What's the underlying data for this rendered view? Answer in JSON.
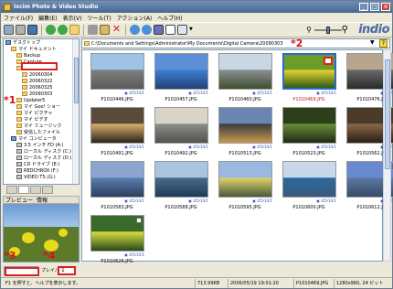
{
  "app": {
    "title": "Ixcim Photo & Video Studio"
  },
  "menu": [
    "ファイル(F)",
    "編集(E)",
    "表示(V)",
    "ツール(T)",
    "アクション(A)",
    "ヘルプ(H)"
  ],
  "logo": {
    "text": "indio",
    "dot": "◦"
  },
  "colors": {
    "accent": "#2a6bd0",
    "marker": "#e01010",
    "logo": "#4b6aa1"
  },
  "tree": [
    {
      "label": "デスクトップ",
      "indent": 0,
      "icon": "desktop"
    },
    {
      "label": "マイ ドキュメント",
      "indent": 1,
      "icon": "folder"
    },
    {
      "label": "Backup",
      "indent": 2,
      "icon": "folder"
    },
    {
      "label": "Capture",
      "indent": 2,
      "icon": "folder"
    },
    {
      "label": "Digital Camera",
      "indent": 2,
      "icon": "folder"
    },
    {
      "label": "20060304",
      "indent": 3,
      "icon": "folder"
    },
    {
      "label": "20060322",
      "indent": 3,
      "icon": "folder"
    },
    {
      "label": "20060325",
      "indent": 3,
      "icon": "folder"
    },
    {
      "label": "20090303",
      "indent": 3,
      "icon": "folder"
    },
    {
      "label": "Updater5",
      "indent": 2,
      "icon": "folder"
    },
    {
      "label": "マイ Goo! ショー",
      "indent": 2,
      "icon": "folder"
    },
    {
      "label": "マイ ピクチャ",
      "indent": 2,
      "icon": "folder"
    },
    {
      "label": "マイ ビデオ",
      "indent": 2,
      "icon": "folder"
    },
    {
      "label": "マイ ミュージック",
      "indent": 2,
      "icon": "folder"
    },
    {
      "label": "受信したファイル",
      "indent": 2,
      "icon": "folder"
    },
    {
      "label": "マイ コンピュータ",
      "indent": 1,
      "icon": "pc"
    },
    {
      "label": "3.5 インチ FD (A:)",
      "indent": 2,
      "icon": "drive"
    },
    {
      "label": "ローカル ディスク (C:)",
      "indent": 2,
      "icon": "drive"
    },
    {
      "label": "ローカル ディスク (D:)",
      "indent": 2,
      "icon": "drive"
    },
    {
      "label": "CD ドライブ (E:)",
      "indent": 2,
      "icon": "drive"
    },
    {
      "label": "REDCHROX (F:)",
      "indent": 2,
      "icon": "drive"
    },
    {
      "label": "VIDEO TS (G:)",
      "indent": 2,
      "icon": "drive"
    }
  ],
  "preview": {
    "tab1": "プレビュー",
    "tab2": "情報"
  },
  "speed": {
    "label": "プレイバー",
    "value": "1"
  },
  "path": "C:\\Documents and Settings\\Administrator\\My Documents\\Digital Camera\\20090303",
  "markers": {
    "m1": {
      "star": "*",
      "num": "1"
    },
    "m2": {
      "star": "*",
      "num": "2"
    },
    "m3": {
      "star": "*",
      "num": "3"
    },
    "m4": {
      "star": "*",
      "num": "4"
    }
  },
  "files": [
    {
      "name": "P1010446.JPG",
      "meta": "▣ 4/5/10/1"
    },
    {
      "name": "P1010457.JPG",
      "meta": "▣ 4/5/10/1"
    },
    {
      "name": "P1010460.JPG",
      "meta": "▣ 4/5/10/1"
    },
    {
      "name": "P1010469.JPG",
      "meta": "▣ 4/5/10/1"
    },
    {
      "name": "P1010476.JPG",
      "meta": "▣ 4/5/10/1"
    },
    {
      "name": "P1010491.JPG",
      "meta": "▣ 4/5/10/1"
    },
    {
      "name": "P1010492.JPG",
      "meta": "▣ 4/5/10/1"
    },
    {
      "name": "P1010513.JPG",
      "meta": "▣ 4/5/10/1"
    },
    {
      "name": "P1010523.JPG",
      "meta": "▣ 4/5/10/1"
    },
    {
      "name": "P1010562.JPG",
      "meta": "▣ 4/5/10/1"
    },
    {
      "name": "P1010583.JPG",
      "meta": "▣ 4/5/10/1"
    },
    {
      "name": "P1010588.JPG",
      "meta": "▣ 4/5/10/1"
    },
    {
      "name": "P1010595.JPG",
      "meta": "▣ 4/5/10/1"
    },
    {
      "name": "P1010600.JPG",
      "meta": "▣ 4/5/10/1"
    },
    {
      "name": "P1010612.JPG",
      "meta": "▣ 4/5/10/1"
    },
    {
      "name": "P1010626.JPG",
      "meta": "▣ 4/5/10/1"
    }
  ],
  "status": {
    "hint": "F1 を押すと、ヘルプを表示します。",
    "size": "713.99KB",
    "date": "2006/05/19 19:01:20",
    "file": "P1010469.JPG",
    "dims": "1280x960, 24 ビット"
  }
}
